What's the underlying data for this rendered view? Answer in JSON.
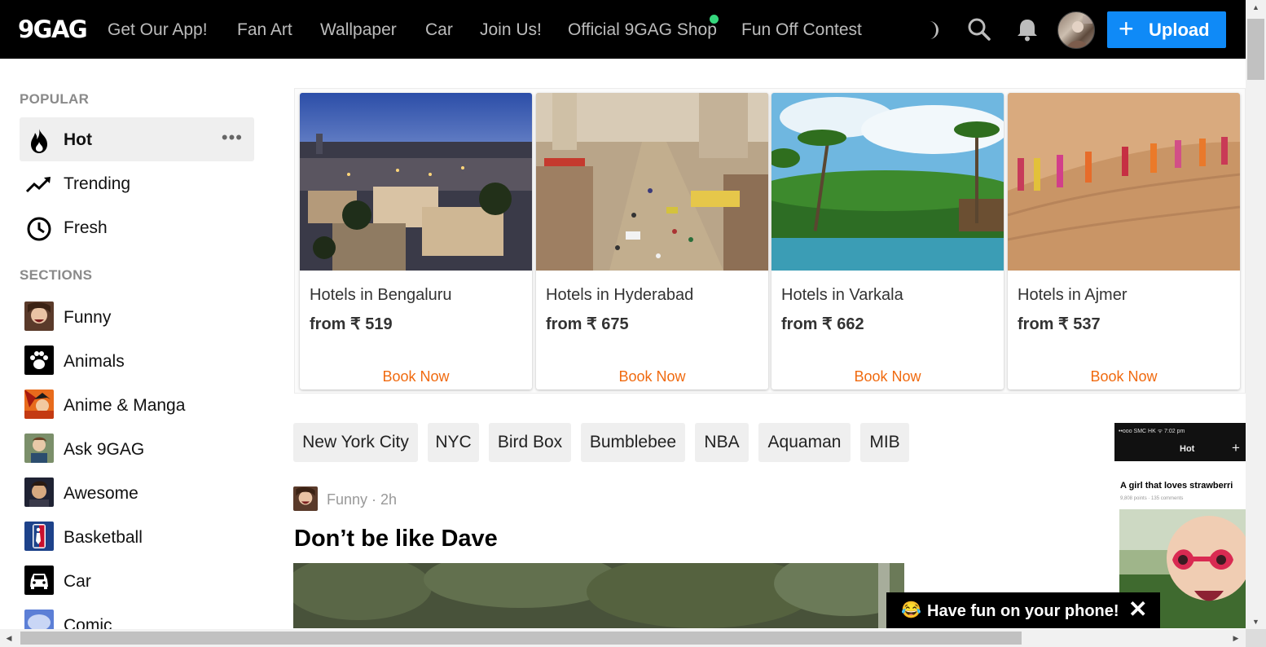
{
  "header": {
    "logo": "9GAG",
    "nav": [
      "Get Our App!",
      "Fan Art",
      "Wallpaper",
      "Car",
      "Join Us!",
      "Official 9GAG Shop",
      "Fun Off Contest"
    ],
    "upload_label": "Upload",
    "upload_plus": "+",
    "icons": [
      "moon-icon",
      "search-icon",
      "bell-icon"
    ],
    "shop_dot_color": "#35d77d",
    "upload_color": "#0f8af7"
  },
  "sidebar": {
    "popular_title": "POPULAR",
    "popular": [
      {
        "label": "Hot",
        "icon": "flame-icon",
        "more": "•••"
      },
      {
        "label": "Trending",
        "icon": "trending-icon"
      },
      {
        "label": "Fresh",
        "icon": "clock-icon"
      }
    ],
    "sections_title": "SECTIONS",
    "sections": [
      {
        "label": "Funny"
      },
      {
        "label": "Animals"
      },
      {
        "label": "Anime & Manga"
      },
      {
        "label": "Ask 9GAG"
      },
      {
        "label": "Awesome"
      },
      {
        "label": "Basketball"
      },
      {
        "label": "Car"
      },
      {
        "label": "Comic"
      }
    ]
  },
  "ad": {
    "hotels": [
      {
        "name": "Hotels in Bengaluru",
        "price": "from ₹ 519",
        "cta": "Book Now"
      },
      {
        "name": "Hotels in Hyderabad",
        "price": "from ₹ 675",
        "cta": "Book Now"
      },
      {
        "name": "Hotels in Varkala",
        "price": "from ₹ 662",
        "cta": "Book Now"
      },
      {
        "name": "Hotels in Ajmer",
        "price": "from ₹ 537",
        "cta": "Book Now"
      }
    ],
    "cta_color": "#f06a0f"
  },
  "tags": [
    "New York City",
    "NYC",
    "Bird Box",
    "Bumblebee",
    "NBA",
    "Aquaman",
    "MIB"
  ],
  "post": {
    "section": "Funny",
    "age": "Funny · 2h",
    "title": "Don’t be like Dave"
  },
  "phone_ad": {
    "status": "••ooo SMC HK  ᯤ          7:02 pm",
    "tab": "Hot",
    "plus": "+",
    "caption": "A girl that loves strawberri",
    "sub": "9,808 points · 135 comments"
  },
  "toast": {
    "emoji": "😂",
    "text": "Have fun on your phone!",
    "close": "✕"
  },
  "scrollbars": {
    "up": "▲",
    "down": "▼",
    "left": "◀",
    "right": "▶"
  }
}
